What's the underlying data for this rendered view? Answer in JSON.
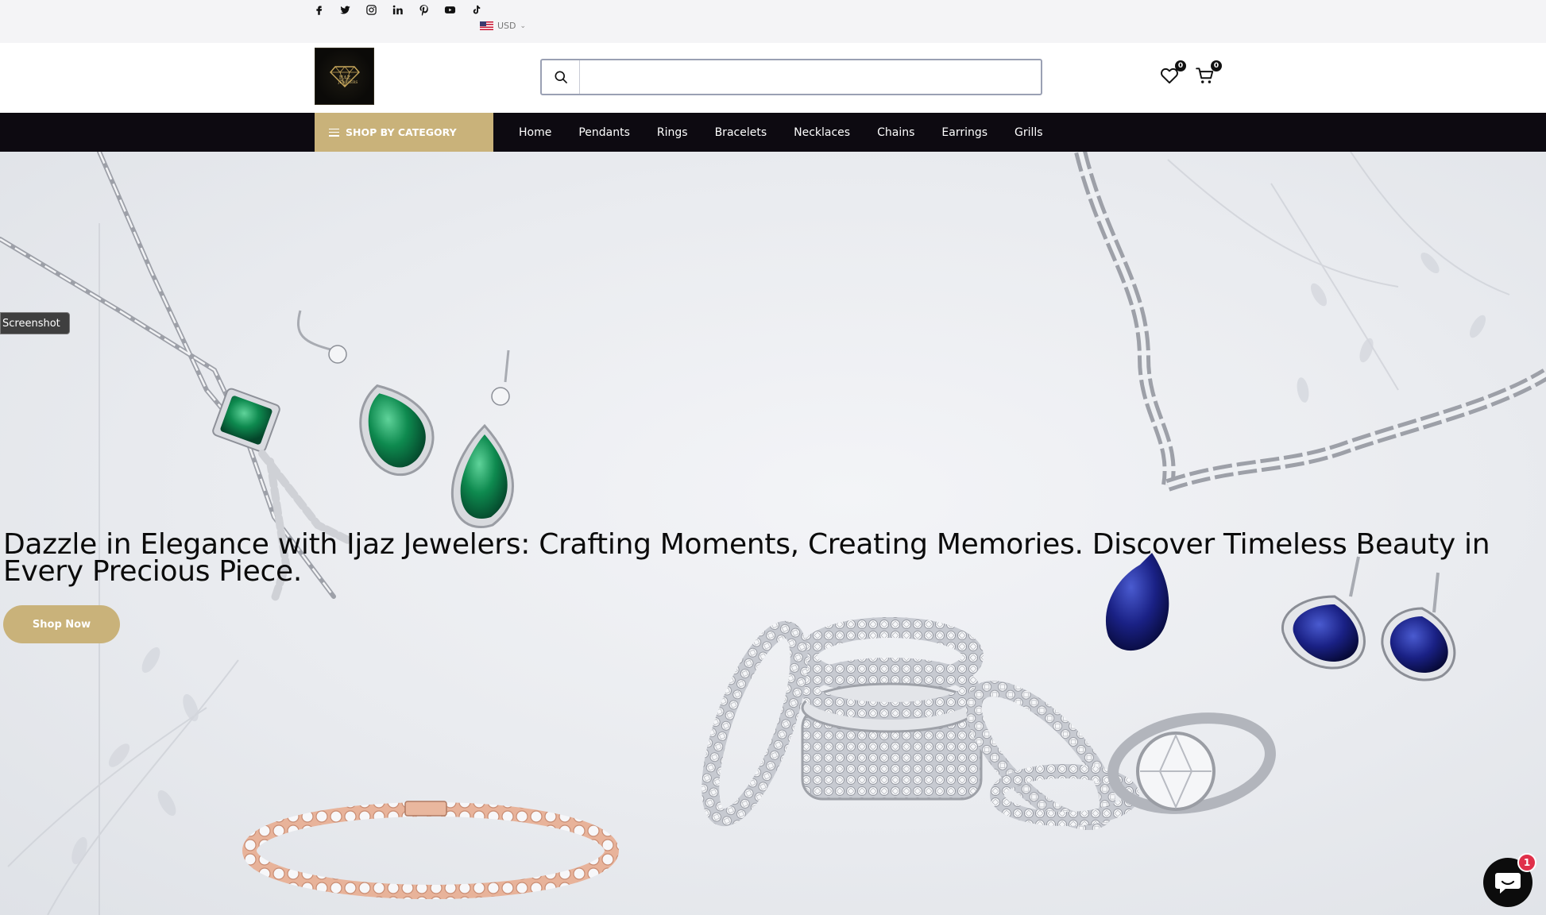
{
  "topbar": {
    "social_icons": [
      "facebook-icon",
      "twitter-icon",
      "instagram-icon",
      "linkedin-icon",
      "pinterest-icon",
      "youtube-icon",
      "tiktok-icon"
    ],
    "currency": "USD"
  },
  "header": {
    "logo_text": "IJAZ JEWELERS",
    "search": {
      "value": "",
      "placeholder": ""
    },
    "wishlist_count": "0",
    "cart_count": "0"
  },
  "nav": {
    "shop_by_category": "SHOP BY CATEGORY",
    "items": [
      "Home",
      "Pendants",
      "Rings",
      "Bracelets",
      "Necklaces",
      "Chains",
      "Earrings",
      "Grills"
    ]
  },
  "hero": {
    "title": "Dazzle in Elegance with Ijaz Jewelers: Crafting Moments, Creating Memories. Discover Timeless Beauty in Every Precious Piece.",
    "cta": "Shop Now"
  },
  "overlay": {
    "screenshot_label": "Screenshot"
  },
  "chat": {
    "badge": "1"
  },
  "colors": {
    "accent": "#c9b27a",
    "nav_bg": "#0d0a11",
    "badge": "#e0304a"
  }
}
